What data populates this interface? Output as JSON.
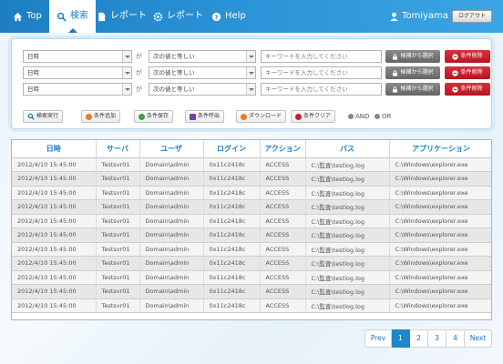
{
  "nav": {
    "top": "Top",
    "search": "検索",
    "report1": "レポート",
    "report2": "レポート",
    "help": "Help",
    "user": "Tomiyama",
    "logout": "ログアウト"
  },
  "conditions": [
    {
      "field": "日時",
      "ga": "が",
      "op": "次の値と等しい",
      "keyword_placeholder": "キーワードを入力してください",
      "candidate": "候補から選択",
      "delete": "条件削除"
    },
    {
      "field": "日時",
      "ga": "が",
      "op": "次の値と等しい",
      "keyword_placeholder": "キーワードを入力してください",
      "candidate": "候補から選択",
      "delete": "条件削除"
    },
    {
      "field": "日時",
      "ga": "が",
      "op": "次の値と等しい",
      "keyword_placeholder": "キーワードを入力してください",
      "candidate": "候補から選択",
      "delete": "条件削除"
    }
  ],
  "actions": {
    "run": "検索実行",
    "add": "条件追加",
    "save": "条件保存",
    "load": "条件呼出",
    "download": "ダウンロード",
    "clear": "条件クリア",
    "and": "AND",
    "or": "OR"
  },
  "colors": {
    "accent": "#1d86cf",
    "delete_red": "#c9202b",
    "candidate_gray": "#777777"
  },
  "table": {
    "headers": [
      "日時",
      "サーバ",
      "ユーザ",
      "ログイン",
      "アクション",
      "パス",
      "アプリケーション"
    ],
    "rows": [
      [
        "2012/4/10  15:45:00",
        "Testsvr01",
        "Domain\\admin",
        "0x11c2418c",
        "ACCESS",
        "C:\\監査\\testlog.log",
        "C:\\Windows\\explorer.exe"
      ],
      [
        "2012/4/10  15:45:00",
        "Testsvr01",
        "Domain\\admin",
        "0x11c2418c",
        "ACCESS",
        "C:\\監査\\testlog.log",
        "C:\\Windows\\explorer.exe"
      ],
      [
        "2012/4/10  15:45:00",
        "Testsvr01",
        "Domain\\admin",
        "0x11c2418c",
        "ACCESS",
        "C:\\監査\\testlog.log",
        "C:\\Windows\\explorer.exe"
      ],
      [
        "2012/4/10  15:45:00",
        "Testsvr01",
        "Domain\\admin",
        "0x11c2418c",
        "ACCESS",
        "C:\\監査\\testlog.log",
        "C:\\Windows\\explorer.exe"
      ],
      [
        "2012/4/10  15:45:00",
        "Testsvr01",
        "Domain\\admin",
        "0x11c2418c",
        "ACCESS",
        "C:\\監査\\testlog.log",
        "C:\\Windows\\explorer.exe"
      ],
      [
        "2012/4/10  15:45:00",
        "Testsvr01",
        "Domain\\admin",
        "0x11c2418c",
        "ACCESS",
        "C:\\監査\\testlog.log",
        "C:\\Windows\\explorer.exe"
      ],
      [
        "2012/4/10  15:45:00",
        "Testsvr01",
        "Domain\\admin",
        "0x11c2418c",
        "ACCESS",
        "C:\\監査\\testlog.log",
        "C:\\Windows\\explorer.exe"
      ],
      [
        "2012/4/10  15:45:00",
        "Testsvr01",
        "Domain\\admin",
        "0x11c2418c",
        "ACCESS",
        "C:\\監査\\testlog.log",
        "C:\\Windows\\explorer.exe"
      ],
      [
        "2012/4/10  15:45:00",
        "Testsvr01",
        "Domain\\admin",
        "0x11c2418c",
        "ACCESS",
        "C:\\監査\\testlog.log",
        "C:\\Windows\\explorer.exe"
      ],
      [
        "2012/4/10  15:45:00",
        "Testsvr01",
        "Domain\\admin",
        "0x11c2418c",
        "ACCESS",
        "C:\\監査\\testlog.log",
        "C:\\Windows\\explorer.exe"
      ],
      [
        "2012/4/10  15:45:00",
        "Testsvr01",
        "Domain\\admin",
        "0x11c2418c",
        "ACCESS",
        "C:\\監査\\testlog.log",
        "C:\\Windows\\explorer.exe"
      ]
    ]
  },
  "pager": {
    "prev": "Prev",
    "pages": [
      "1",
      "2",
      "3",
      "4"
    ],
    "current": "1",
    "next": "Next"
  }
}
